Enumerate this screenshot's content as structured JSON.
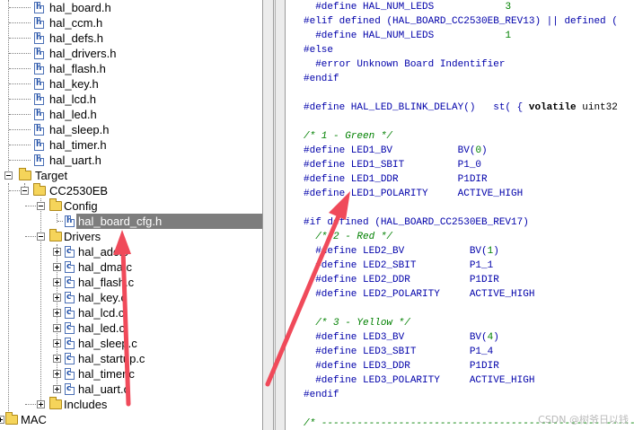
{
  "tree": {
    "top_files": [
      "hal_board.h",
      "hal_ccm.h",
      "hal_defs.h",
      "hal_drivers.h",
      "hal_flash.h",
      "hal_key.h",
      "hal_lcd.h",
      "hal_led.h",
      "hal_sleep.h",
      "hal_timer.h",
      "hal_uart.h"
    ],
    "target": "Target",
    "board": "CC2530EB",
    "config": "Config",
    "selected_file": "hal_board_cfg.h",
    "drivers": "Drivers",
    "driver_files": [
      "hal_adc.c",
      "hal_dma.c",
      "hal_flash.c",
      "hal_key.c",
      "hal_lcd.c",
      "hal_led.c",
      "hal_sleep.c",
      "hal_startup.c",
      "hal_timer.c",
      "hal_uart.c"
    ],
    "includes": "Includes",
    "mac": "MAC"
  },
  "code": {
    "l0_a": "  #define HAL_NUM_LEDS",
    "l0_b": "            3",
    "l1_a": "#elif defined (HAL_BOARD_CC2530EB_REV13) || defined (",
    "l2_a": "  #define HAL_NUM_LEDS",
    "l2_b": "            1",
    "l3_a": "#else",
    "l4_a": "  #error Unknown Board Indentifier",
    "l5_a": "#endif",
    "l7_a": "#define HAL_LED_BLINK_DELAY()   st( { ",
    "l7_b": "volatile",
    "l7_c": " uint32",
    "l9_a": "/* 1 - Green */",
    "l10_a": "#define LED1_BV           BV(",
    "l10_b": "0",
    "l10_c": ")",
    "l11_a": "#define LED1_SBIT         P1_0",
    "l12_a": "#define LED1_DDR          P1DIR",
    "l13_a": "#define LED1_POLARITY     ACTIVE_HIGH",
    "l15_a": "#if defined (HAL_BOARD_CC2530EB_REV17)",
    "l16_a": "  /* 2 - Red */",
    "l17_a": "  #define LED2_BV           BV(",
    "l17_b": "1",
    "l17_c": ")",
    "l18_a": "  #define LED2_SBIT         P1_1",
    "l19_a": "  #define LED2_DDR          P1DIR",
    "l20_a": "  #define LED2_POLARITY     ACTIVE_HIGH",
    "l22_a": "  /* 3 - Yellow */",
    "l23_a": "  #define LED3_BV           BV(",
    "l23_b": "4",
    "l23_c": ")",
    "l24_a": "  #define LED3_SBIT         P1_4",
    "l25_a": "  #define LED3_DDR          P1DIR",
    "l26_a": "  #define LED3_POLARITY     ACTIVE_HIGH",
    "l27_a": "#endif",
    "l29_a": "/* -------------------------------------------------------"
  },
  "watermark": "CSDN @树爷日以钱",
  "colors": {
    "selection": "#7d7d7d",
    "preprocessor": "#0000aa",
    "comment": "#008000",
    "arrow": "#f04a5a"
  }
}
